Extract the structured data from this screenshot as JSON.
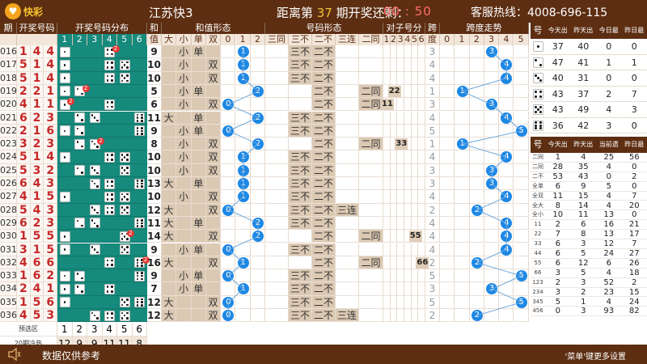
{
  "topbar": {
    "logo": "快彩",
    "title": "江苏快3",
    "countdown_prefix": "距离第",
    "countdown_issue": "37",
    "countdown_suffix": "期开奖还剩：",
    "clock": "00 : 50",
    "hotline": "客服热线：4008-696-115"
  },
  "headers": {
    "issue": "期号",
    "num": "开奖号码",
    "dist": "开奖号码分布",
    "sum_top": "和值",
    "sumform": "和值形态",
    "numform": "号码形态",
    "pair": "对子号分",
    "span_top": "跨度",
    "spantrend": "跨度走势",
    "dist_cols": [
      "1",
      "2",
      "3",
      "4",
      "5",
      "6"
    ],
    "sum_bottom": "值",
    "sumform_cols": [
      "大",
      "小",
      "单",
      "双",
      "0",
      "1",
      "2"
    ],
    "numform_cols": [
      "三同",
      "三不",
      "二不",
      "三连",
      "二同"
    ],
    "pair_cols": [
      "1",
      "2",
      "3",
      "4",
      "5",
      "6"
    ],
    "span_bottom": "度",
    "spantrend_cols": [
      "0",
      "1",
      "2",
      "3",
      "4",
      "5"
    ]
  },
  "rows": [
    {
      "issue": "016",
      "nums": [
        1,
        4,
        4
      ],
      "sum": "9",
      "big": "",
      "small": "小",
      "odd": "单",
      "even": "",
      "r": 1,
      "same3": "",
      "diff3": "三不",
      "diff2": "二不",
      "seq3": "",
      "same2": "",
      "pair": "",
      "span": "3"
    },
    {
      "issue": "017",
      "nums": [
        5,
        1,
        4
      ],
      "sum": "10",
      "big": "",
      "small": "小",
      "odd": "",
      "even": "双",
      "r": 1,
      "same3": "",
      "diff3": "三不",
      "diff2": "二不",
      "seq3": "",
      "same2": "",
      "pair": "",
      "span": "4"
    },
    {
      "issue": "018",
      "nums": [
        5,
        1,
        4
      ],
      "sum": "10",
      "big": "",
      "small": "小",
      "odd": "",
      "even": "双",
      "r": 1,
      "same3": "",
      "diff3": "三不",
      "diff2": "二不",
      "seq3": "",
      "same2": "",
      "pair": "",
      "span": "4"
    },
    {
      "issue": "019",
      "nums": [
        2,
        2,
        1
      ],
      "sum": "5",
      "big": "",
      "small": "小",
      "odd": "单",
      "even": "",
      "r": 2,
      "same3": "",
      "diff3": "",
      "diff2": "二不",
      "seq3": "",
      "same2": "二同",
      "pair": "22",
      "span": "1"
    },
    {
      "issue": "020",
      "nums": [
        4,
        1,
        1
      ],
      "sum": "6",
      "big": "",
      "small": "小",
      "odd": "",
      "even": "双",
      "r": 0,
      "same3": "",
      "diff3": "",
      "diff2": "二不",
      "seq3": "",
      "same2": "二同",
      "pair": "11",
      "span": "3"
    },
    {
      "issue": "021",
      "nums": [
        6,
        2,
        3
      ],
      "sum": "11",
      "big": "大",
      "small": "",
      "odd": "单",
      "even": "",
      "r": 2,
      "same3": "",
      "diff3": "三不",
      "diff2": "二不",
      "seq3": "",
      "same2": "",
      "pair": "",
      "span": "4"
    },
    {
      "issue": "022",
      "nums": [
        2,
        1,
        6
      ],
      "sum": "9",
      "big": "",
      "small": "小",
      "odd": "单",
      "even": "",
      "r": 0,
      "same3": "",
      "diff3": "三不",
      "diff2": "二不",
      "seq3": "",
      "same2": "",
      "pair": "",
      "span": "5"
    },
    {
      "issue": "023",
      "nums": [
        3,
        2,
        3
      ],
      "sum": "8",
      "big": "",
      "small": "小",
      "odd": "",
      "even": "双",
      "r": 2,
      "same3": "",
      "diff3": "",
      "diff2": "二不",
      "seq3": "",
      "same2": "二同",
      "pair": "33",
      "span": "1"
    },
    {
      "issue": "024",
      "nums": [
        5,
        1,
        4
      ],
      "sum": "10",
      "big": "",
      "small": "小",
      "odd": "",
      "even": "双",
      "r": 1,
      "same3": "",
      "diff3": "三不",
      "diff2": "二不",
      "seq3": "",
      "same2": "",
      "pair": "",
      "span": "4"
    },
    {
      "issue": "025",
      "nums": [
        5,
        3,
        2
      ],
      "sum": "10",
      "big": "",
      "small": "小",
      "odd": "",
      "even": "双",
      "r": 1,
      "same3": "",
      "diff3": "三不",
      "diff2": "二不",
      "seq3": "",
      "same2": "",
      "pair": "",
      "span": "3"
    },
    {
      "issue": "026",
      "nums": [
        6,
        4,
        3
      ],
      "sum": "13",
      "big": "大",
      "small": "",
      "odd": "单",
      "even": "",
      "r": 1,
      "same3": "",
      "diff3": "三不",
      "diff2": "二不",
      "seq3": "",
      "same2": "",
      "pair": "",
      "span": "3"
    },
    {
      "issue": "027",
      "nums": [
        4,
        1,
        5
      ],
      "sum": "10",
      "big": "",
      "small": "小",
      "odd": "",
      "even": "双",
      "r": 1,
      "same3": "",
      "diff3": "三不",
      "diff2": "二不",
      "seq3": "",
      "same2": "",
      "pair": "",
      "span": "4"
    },
    {
      "issue": "028",
      "nums": [
        5,
        4,
        3
      ],
      "sum": "12",
      "big": "大",
      "small": "",
      "odd": "",
      "even": "双",
      "r": 0,
      "same3": "",
      "diff3": "三不",
      "diff2": "二不",
      "seq3": "三连",
      "same2": "",
      "pair": "",
      "span": "2"
    },
    {
      "issue": "029",
      "nums": [
        6,
        2,
        3
      ],
      "sum": "11",
      "big": "大",
      "small": "",
      "odd": "单",
      "even": "",
      "r": 2,
      "same3": "",
      "diff3": "三不",
      "diff2": "二不",
      "seq3": "",
      "same2": "",
      "pair": "",
      "span": "4"
    },
    {
      "issue": "030",
      "nums": [
        1,
        5,
        5
      ],
      "sum": "14",
      "big": "大",
      "small": "",
      "odd": "",
      "even": "双",
      "r": 2,
      "same3": "",
      "diff3": "",
      "diff2": "二不",
      "seq3": "",
      "same2": "二同",
      "pair": "55",
      "span": "4"
    },
    {
      "issue": "031",
      "nums": [
        3,
        1,
        5
      ],
      "sum": "9",
      "big": "",
      "small": "小",
      "odd": "单",
      "even": "",
      "r": 0,
      "same3": "",
      "diff3": "三不",
      "diff2": "二不",
      "seq3": "",
      "same2": "",
      "pair": "",
      "span": "4"
    },
    {
      "issue": "032",
      "nums": [
        4,
        6,
        6
      ],
      "sum": "16",
      "big": "大",
      "small": "",
      "odd": "",
      "even": "双",
      "r": 1,
      "same3": "",
      "diff3": "",
      "diff2": "二不",
      "seq3": "",
      "same2": "二同",
      "pair": "66",
      "span": "2"
    },
    {
      "issue": "033",
      "nums": [
        1,
        6,
        2
      ],
      "sum": "9",
      "big": "",
      "small": "小",
      "odd": "单",
      "even": "",
      "r": 0,
      "same3": "",
      "diff3": "三不",
      "diff2": "二不",
      "seq3": "",
      "same2": "",
      "pair": "",
      "span": "5"
    },
    {
      "issue": "034",
      "nums": [
        2,
        4,
        1
      ],
      "sum": "7",
      "big": "",
      "small": "小",
      "odd": "单",
      "even": "",
      "r": 1,
      "same3": "",
      "diff3": "三不",
      "diff2": "二不",
      "seq3": "",
      "same2": "",
      "pair": "",
      "span": "3"
    },
    {
      "issue": "035",
      "nums": [
        1,
        5,
        6
      ],
      "sum": "12",
      "big": "大",
      "small": "",
      "odd": "",
      "even": "双",
      "r": 0,
      "same3": "",
      "diff3": "三不",
      "diff2": "二不",
      "seq3": "",
      "same2": "",
      "pair": "",
      "span": "5"
    },
    {
      "issue": "036",
      "nums": [
        4,
        5,
        3
      ],
      "sum": "12",
      "big": "大",
      "small": "",
      "odd": "",
      "even": "双",
      "r": 0,
      "same3": "",
      "diff3": "三不",
      "diff2": "二不",
      "seq3": "三连",
      "same2": "",
      "pair": "",
      "span": "2"
    }
  ],
  "footer": {
    "preselect_label": "预选区",
    "preselect": [
      "1",
      "2",
      "3",
      "4",
      "5",
      "6"
    ],
    "hot_label": "20期冷热",
    "hot": [
      "12",
      "9",
      "9",
      "11",
      "11",
      "8"
    ]
  },
  "side_top": {
    "headers": [
      "号",
      "今天出现",
      "昨天出现",
      "今日最大遗漏",
      "昨日最大遗漏"
    ],
    "rows": [
      {
        "face": 1,
        "v": [
          "37",
          "40",
          "0",
          "0"
        ]
      },
      {
        "face": 2,
        "v": [
          "47",
          "41",
          "1",
          "1"
        ]
      },
      {
        "face": 3,
        "v": [
          "40",
          "31",
          "0",
          "0"
        ]
      },
      {
        "face": 4,
        "v": [
          "43",
          "37",
          "2",
          "7"
        ]
      },
      {
        "face": 5,
        "v": [
          "43",
          "49",
          "4",
          "3"
        ]
      },
      {
        "face": 6,
        "v": [
          "36",
          "42",
          "3",
          "0"
        ]
      }
    ]
  },
  "side_bottom": {
    "headers": [
      "号",
      "今天出现",
      "昨天出现",
      "当前遗漏",
      "昨日最大"
    ],
    "rows": [
      {
        "k": "二同",
        "v": [
          "1",
          "4",
          "25",
          "56"
        ]
      },
      {
        "k": "二同",
        "v": [
          "28",
          "35",
          "4",
          "0"
        ]
      },
      {
        "k": "二不",
        "v": [
          "53",
          "43",
          "0",
          "2"
        ]
      },
      {
        "k": "全单",
        "v": [
          "6",
          "9",
          "5",
          "0"
        ]
      },
      {
        "k": "全双",
        "v": [
          "11",
          "15",
          "4",
          "7"
        ]
      },
      {
        "k": "全大",
        "v": [
          "8",
          "14",
          "4",
          "20"
        ]
      },
      {
        "k": "全小",
        "v": [
          "10",
          "11",
          "13",
          "0"
        ]
      },
      {
        "k": "11",
        "v": [
          "2",
          "6",
          "16",
          "21"
        ]
      },
      {
        "k": "22",
        "v": [
          "7",
          "8",
          "13",
          "17"
        ]
      },
      {
        "k": "33",
        "v": [
          "6",
          "3",
          "12",
          "7"
        ]
      },
      {
        "k": "44",
        "v": [
          "6",
          "5",
          "24",
          "27"
        ]
      },
      {
        "k": "55",
        "v": [
          "6",
          "12",
          "6",
          "26"
        ]
      },
      {
        "k": "66",
        "v": [
          "3",
          "5",
          "4",
          "18"
        ]
      },
      {
        "k": "123",
        "v": [
          "2",
          "3",
          "52",
          "2"
        ]
      },
      {
        "k": "234",
        "v": [
          "3",
          "2",
          "23",
          "15"
        ]
      },
      {
        "k": "345",
        "v": [
          "5",
          "1",
          "4",
          "24"
        ]
      },
      {
        "k": "456",
        "v": [
          "0",
          "3",
          "93",
          "82"
        ]
      }
    ]
  },
  "bottombar": {
    "text": "数据仅供参考",
    "right": "'菜单'键更多设置"
  },
  "colors": {
    "brown": "#5d2e12",
    "teal": "#168a7c",
    "blue": "#1e88e5",
    "red": "#c62828"
  }
}
